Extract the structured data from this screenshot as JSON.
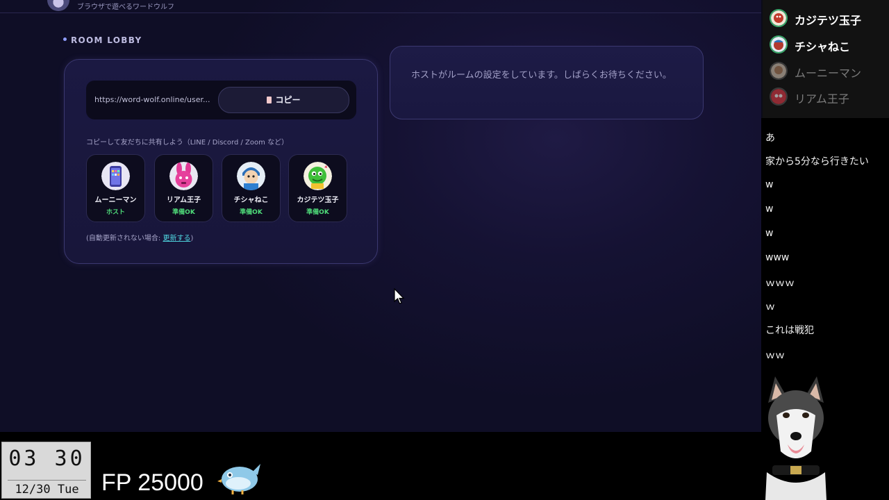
{
  "app": {
    "tagline": "ブラウザで遊べるワードウルフ"
  },
  "lobby": {
    "heading": "ROOM LOBBY",
    "invite_url": "https://word-wolf.online/user...",
    "copy_label": "コピー",
    "share_hint": "コピーして友だちに共有しよう（LINE / Discord / Zoom など）",
    "players": [
      {
        "name": "ムーニーマン",
        "status": "ホスト"
      },
      {
        "name": "リアム王子",
        "status": "準備OK"
      },
      {
        "name": "チシャねこ",
        "status": "準備OK"
      },
      {
        "name": "カジテツ玉子",
        "status": "準備OK"
      }
    ],
    "refresh_prefix": "(自動更新されない場合: ",
    "refresh_link": "更新する",
    "refresh_suffix": ")"
  },
  "waiting": {
    "message": "ホストがルームの設定をしています。しばらくお待ちください。"
  },
  "participants": [
    {
      "name": "カジテツ玉子",
      "active": true
    },
    {
      "name": "チシャねこ",
      "active": true
    },
    {
      "name": "ムーニーマン",
      "active": false
    },
    {
      "name": "リアム王子",
      "active": false
    }
  ],
  "chat": [
    "あ",
    "家から5分なら行きたい",
    "w",
    "w",
    "w",
    "www",
    "ｗｗｗ",
    "ｗ",
    "これは戦犯",
    "ｗｗ"
  ],
  "overlay": {
    "clock_time": "03 30",
    "clock_date": "12/30 Tue",
    "fp_counter": "FP 25000"
  },
  "colors": {
    "accent_green": "#4fdc7a",
    "link_cyan": "#4fd6e0"
  }
}
